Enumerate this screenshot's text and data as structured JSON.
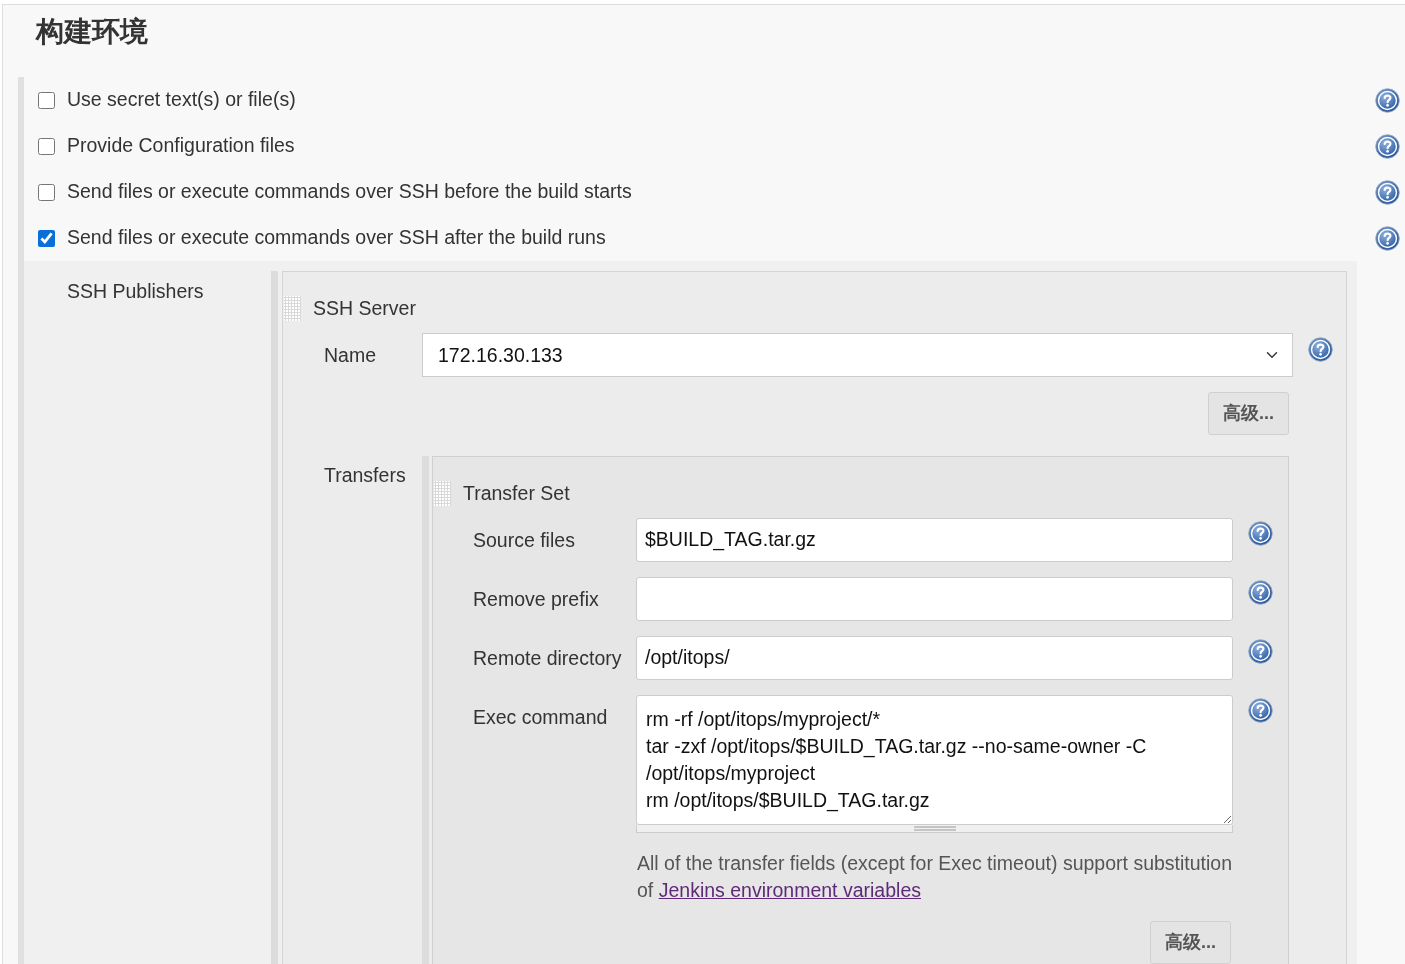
{
  "section_title": "构建环境",
  "options": [
    {
      "label": "Use secret text(s) or file(s)",
      "checked": false
    },
    {
      "label": "Provide Configuration files",
      "checked": false
    },
    {
      "label": "Send files or execute commands over SSH before the build starts",
      "checked": false
    },
    {
      "label": "Send files or execute commands over SSH after the build runs",
      "checked": true
    }
  ],
  "ssh_publishers": {
    "label": "SSH Publishers",
    "server": {
      "title": "SSH Server",
      "name_label": "Name",
      "name_value": "172.16.30.133",
      "advanced_button": "高级..."
    },
    "transfers": {
      "label": "Transfers",
      "set_title": "Transfer Set",
      "fields": [
        {
          "kind": "input",
          "label": "Source files",
          "value": "$BUILD_TAG.tar.gz"
        },
        {
          "kind": "input",
          "label": "Remove prefix"
        },
        {
          "kind": "input",
          "label": "Remote directory",
          "value": "/opt/itops/"
        },
        {
          "kind": "textarea",
          "label": "Exec command",
          "value": "rm -rf /opt/itops/myproject/*\ntar -zxf /opt/itops/$BUILD_TAG.tar.gz --no-same-owner -C /opt/itops/myproject\nrm /opt/itops/$BUILD_TAG.tar.gz"
        }
      ],
      "note": "All of the transfer fields (except for Exec timeout) support substitution of",
      "note_link": "Jenkins environment variables",
      "advanced_button": "高级..."
    }
  }
}
